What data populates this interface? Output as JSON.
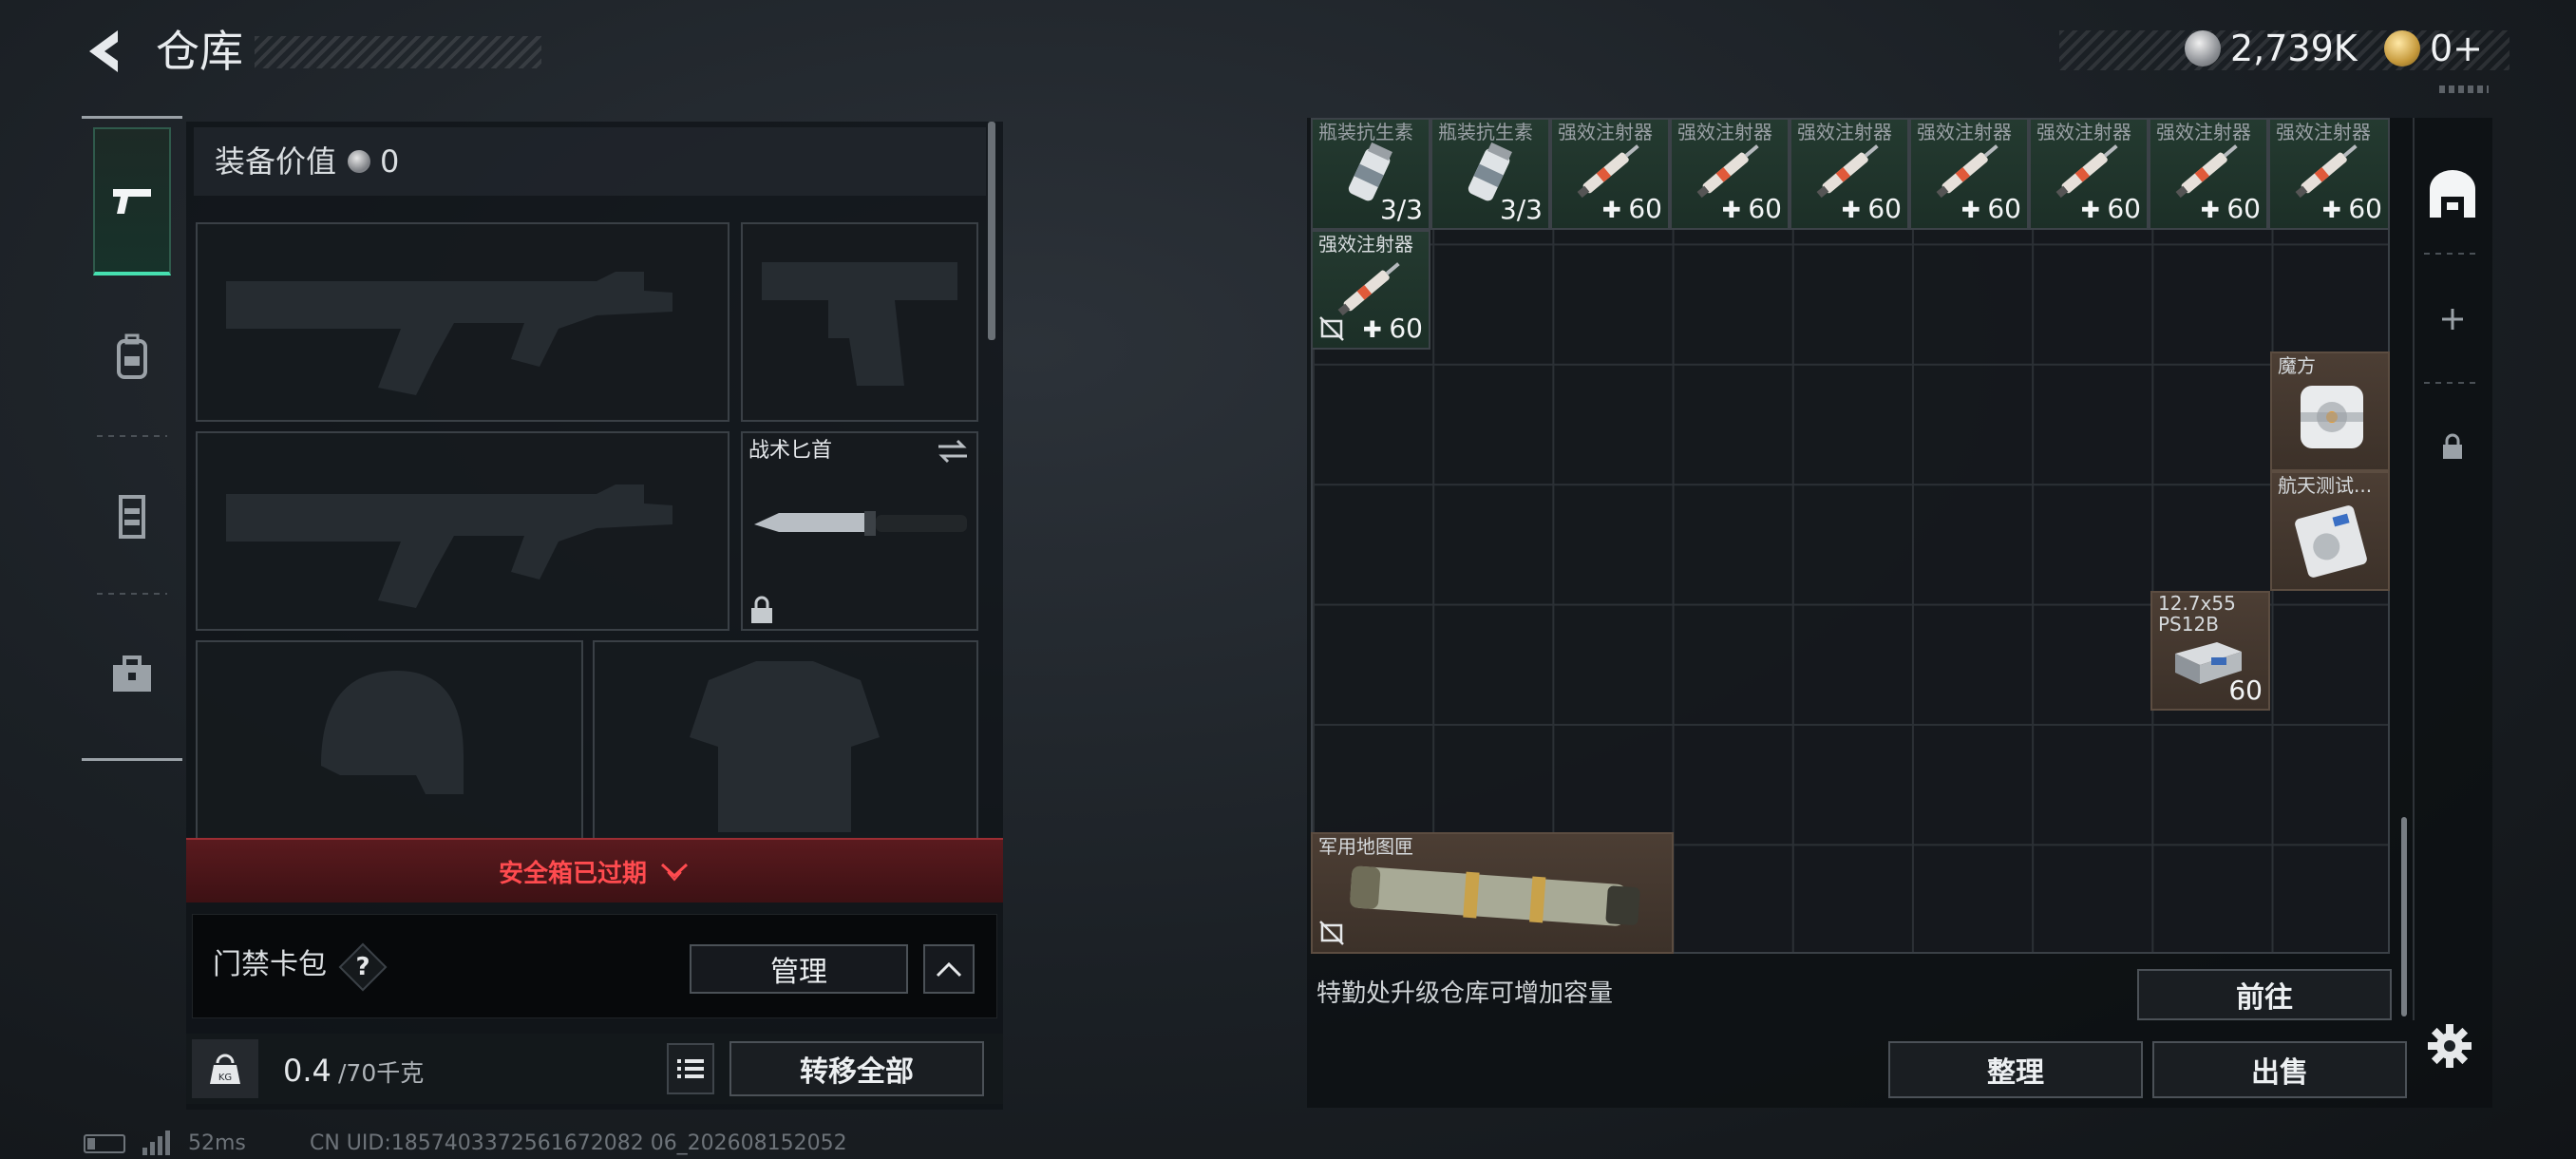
{
  "header": {
    "title": "仓库",
    "currency_silver": "2,739K",
    "currency_gold": "0+"
  },
  "nav": {
    "items": [
      {
        "icon": "pistol-icon",
        "active": true
      },
      {
        "icon": "backpack-icon",
        "active": false
      },
      {
        "icon": "vest-icon",
        "active": false
      },
      {
        "icon": "case-icon",
        "active": false
      }
    ]
  },
  "loadout": {
    "value_label": "装备价值",
    "value_amount": "0",
    "melee_name": "战术匕首",
    "safe_box_status": "安全箱已过期",
    "keycard_label": "门禁卡包",
    "keycard_help": "?",
    "manage_label": "管理",
    "weight_current": "0.4",
    "weight_max": "/70千克",
    "transfer_all_label": "转移全部"
  },
  "stash": {
    "items": [
      {
        "name": "瓶装抗生素",
        "count": "3/3",
        "type": "count",
        "style": "green",
        "icon": "bottle-icon"
      },
      {
        "name": "瓶装抗生素",
        "count": "3/3",
        "type": "count",
        "style": "green",
        "icon": "bottle-icon"
      },
      {
        "name": "强效注射器",
        "count": "60",
        "type": "heal",
        "style": "green",
        "icon": "syringe-icon"
      },
      {
        "name": "强效注射器",
        "count": "60",
        "type": "heal",
        "style": "green",
        "icon": "syringe-icon"
      },
      {
        "name": "强效注射器",
        "count": "60",
        "type": "heal",
        "style": "green",
        "icon": "syringe-icon"
      },
      {
        "name": "强效注射器",
        "count": "60",
        "type": "heal",
        "style": "green",
        "icon": "syringe-icon"
      },
      {
        "name": "强效注射器",
        "count": "60",
        "type": "heal",
        "style": "green",
        "icon": "syringe-icon"
      },
      {
        "name": "强效注射器",
        "count": "60",
        "type": "heal",
        "style": "green",
        "icon": "syringe-icon"
      },
      {
        "name": "强效注射器",
        "count": "60",
        "type": "heal",
        "style": "green",
        "icon": "syringe-icon"
      },
      {
        "name": "强效注射器",
        "count": "60",
        "type": "heal",
        "style": "green",
        "icon": "syringe-icon"
      },
      {
        "name": "魔方",
        "count": "",
        "type": "none",
        "style": "brown",
        "icon": "cube-icon"
      },
      {
        "name": "航天测试...",
        "count": "",
        "type": "none",
        "style": "brown",
        "icon": "space-device-icon"
      },
      {
        "name": "12.7x55 PS12B",
        "count": "60",
        "type": "count",
        "style": "brown",
        "icon": "ammo-box-icon"
      },
      {
        "name": "军用地图匣",
        "count": "",
        "type": "none",
        "style": "brown",
        "icon": "map-tube-icon"
      }
    ],
    "upgrade_note": "特勤处升级仓库可增加容量",
    "goto_label": "前往",
    "sort_label": "整理",
    "sell_label": "出售"
  },
  "status": {
    "ping": "52ms",
    "uid": "CN UID:1857403372561672082 06_202608152052"
  },
  "colors": {
    "accent_green": "#46e0b0",
    "danger_red": "#ff4b4f",
    "item_green": "#243a30",
    "item_brown": "#4c3e34"
  }
}
